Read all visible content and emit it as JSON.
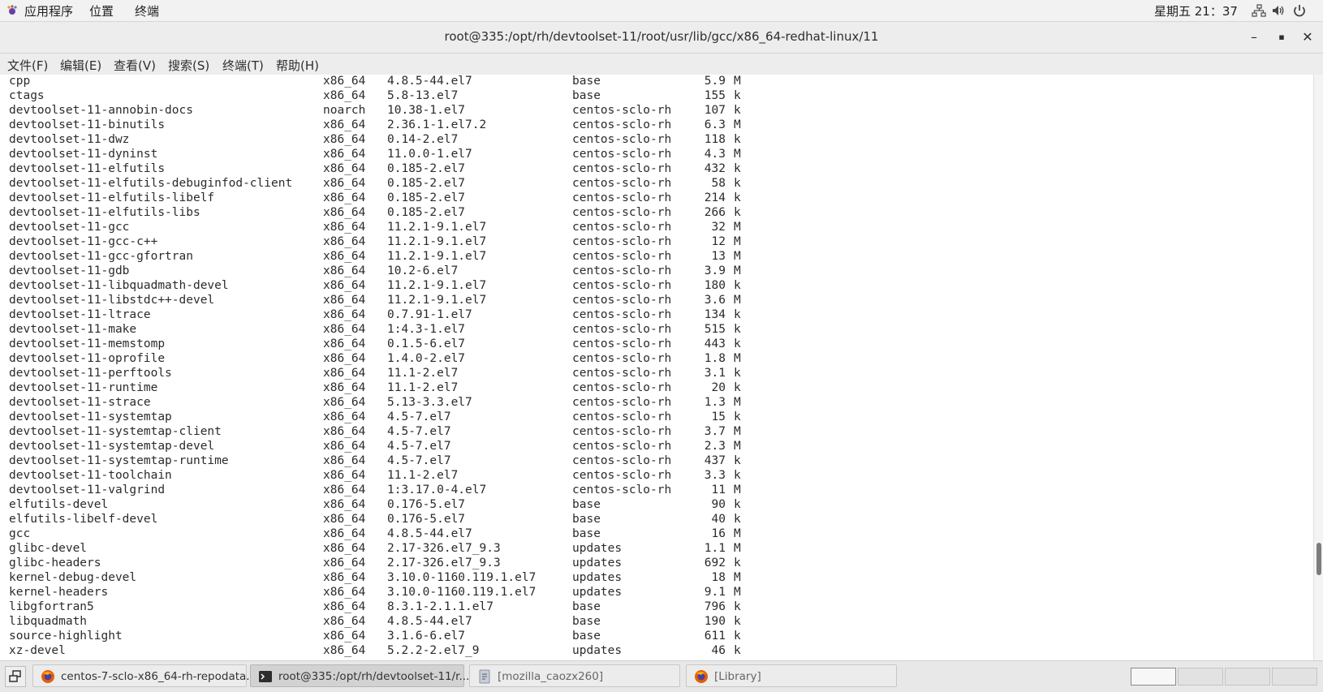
{
  "top_panel": {
    "applications": "应用程序",
    "places": "位置",
    "terminal": "终端",
    "clock": "星期五 21：37",
    "icons": [
      "network-icon",
      "volume-icon",
      "power-icon"
    ]
  },
  "window": {
    "title": "root@335:/opt/rh/devtoolset-11/root/usr/lib/gcc/x86_64-redhat-linux/11",
    "minimize": "–",
    "maximize": "▪",
    "close": "✕"
  },
  "menubar": {
    "file": "文件(F)",
    "edit": "编辑(E)",
    "view": "查看(V)",
    "search": "搜索(S)",
    "terminal": "终端(T)",
    "help": "帮助(H)"
  },
  "terminal": {
    "rows": [
      [
        "cpp",
        "x86_64",
        "4.8.5-44.el7",
        "base",
        "5.9",
        "M"
      ],
      [
        "ctags",
        "x86_64",
        "5.8-13.el7",
        "base",
        "155",
        "k"
      ],
      [
        "devtoolset-11-annobin-docs",
        "noarch",
        "10.38-1.el7",
        "centos-sclo-rh",
        "107",
        "k"
      ],
      [
        "devtoolset-11-binutils",
        "x86_64",
        "2.36.1-1.el7.2",
        "centos-sclo-rh",
        "6.3",
        "M"
      ],
      [
        "devtoolset-11-dwz",
        "x86_64",
        "0.14-2.el7",
        "centos-sclo-rh",
        "118",
        "k"
      ],
      [
        "devtoolset-11-dyninst",
        "x86_64",
        "11.0.0-1.el7",
        "centos-sclo-rh",
        "4.3",
        "M"
      ],
      [
        "devtoolset-11-elfutils",
        "x86_64",
        "0.185-2.el7",
        "centos-sclo-rh",
        "432",
        "k"
      ],
      [
        "devtoolset-11-elfutils-debuginfod-client",
        "x86_64",
        "0.185-2.el7",
        "centos-sclo-rh",
        "58",
        "k"
      ],
      [
        "devtoolset-11-elfutils-libelf",
        "x86_64",
        "0.185-2.el7",
        "centos-sclo-rh",
        "214",
        "k"
      ],
      [
        "devtoolset-11-elfutils-libs",
        "x86_64",
        "0.185-2.el7",
        "centos-sclo-rh",
        "266",
        "k"
      ],
      [
        "devtoolset-11-gcc",
        "x86_64",
        "11.2.1-9.1.el7",
        "centos-sclo-rh",
        "32",
        "M"
      ],
      [
        "devtoolset-11-gcc-c++",
        "x86_64",
        "11.2.1-9.1.el7",
        "centos-sclo-rh",
        "12",
        "M"
      ],
      [
        "devtoolset-11-gcc-gfortran",
        "x86_64",
        "11.2.1-9.1.el7",
        "centos-sclo-rh",
        "13",
        "M"
      ],
      [
        "devtoolset-11-gdb",
        "x86_64",
        "10.2-6.el7",
        "centos-sclo-rh",
        "3.9",
        "M"
      ],
      [
        "devtoolset-11-libquadmath-devel",
        "x86_64",
        "11.2.1-9.1.el7",
        "centos-sclo-rh",
        "180",
        "k"
      ],
      [
        "devtoolset-11-libstdc++-devel",
        "x86_64",
        "11.2.1-9.1.el7",
        "centos-sclo-rh",
        "3.6",
        "M"
      ],
      [
        "devtoolset-11-ltrace",
        "x86_64",
        "0.7.91-1.el7",
        "centos-sclo-rh",
        "134",
        "k"
      ],
      [
        "devtoolset-11-make",
        "x86_64",
        "1:4.3-1.el7",
        "centos-sclo-rh",
        "515",
        "k"
      ],
      [
        "devtoolset-11-memstomp",
        "x86_64",
        "0.1.5-6.el7",
        "centos-sclo-rh",
        "443",
        "k"
      ],
      [
        "devtoolset-11-oprofile",
        "x86_64",
        "1.4.0-2.el7",
        "centos-sclo-rh",
        "1.8",
        "M"
      ],
      [
        "devtoolset-11-perftools",
        "x86_64",
        "11.1-2.el7",
        "centos-sclo-rh",
        "3.1",
        "k"
      ],
      [
        "devtoolset-11-runtime",
        "x86_64",
        "11.1-2.el7",
        "centos-sclo-rh",
        "20",
        "k"
      ],
      [
        "devtoolset-11-strace",
        "x86_64",
        "5.13-3.3.el7",
        "centos-sclo-rh",
        "1.3",
        "M"
      ],
      [
        "devtoolset-11-systemtap",
        "x86_64",
        "4.5-7.el7",
        "centos-sclo-rh",
        "15",
        "k"
      ],
      [
        "devtoolset-11-systemtap-client",
        "x86_64",
        "4.5-7.el7",
        "centos-sclo-rh",
        "3.7",
        "M"
      ],
      [
        "devtoolset-11-systemtap-devel",
        "x86_64",
        "4.5-7.el7",
        "centos-sclo-rh",
        "2.3",
        "M"
      ],
      [
        "devtoolset-11-systemtap-runtime",
        "x86_64",
        "4.5-7.el7",
        "centos-sclo-rh",
        "437",
        "k"
      ],
      [
        "devtoolset-11-toolchain",
        "x86_64",
        "11.1-2.el7",
        "centos-sclo-rh",
        "3.3",
        "k"
      ],
      [
        "devtoolset-11-valgrind",
        "x86_64",
        "1:3.17.0-4.el7",
        "centos-sclo-rh",
        "11",
        "M"
      ],
      [
        "elfutils-devel",
        "x86_64",
        "0.176-5.el7",
        "base",
        "90",
        "k"
      ],
      [
        "elfutils-libelf-devel",
        "x86_64",
        "0.176-5.el7",
        "base",
        "40",
        "k"
      ],
      [
        "gcc",
        "x86_64",
        "4.8.5-44.el7",
        "base",
        "16",
        "M"
      ],
      [
        "glibc-devel",
        "x86_64",
        "2.17-326.el7_9.3",
        "updates",
        "1.1",
        "M"
      ],
      [
        "glibc-headers",
        "x86_64",
        "2.17-326.el7_9.3",
        "updates",
        "692",
        "k"
      ],
      [
        "kernel-debug-devel",
        "x86_64",
        "3.10.0-1160.119.1.el7",
        "updates",
        "18",
        "M"
      ],
      [
        "kernel-headers",
        "x86_64",
        "3.10.0-1160.119.1.el7",
        "updates",
        "9.1",
        "M"
      ],
      [
        "libgfortran5",
        "x86_64",
        "8.3.1-2.1.1.el7",
        "base",
        "796",
        "k"
      ],
      [
        "libquadmath",
        "x86_64",
        "4.8.5-44.el7",
        "base",
        "190",
        "k"
      ],
      [
        "source-highlight",
        "x86_64",
        "3.1.6-6.el7",
        "base",
        "611",
        "k"
      ],
      [
        "xz-devel",
        "x86_64",
        "5.2.2-2.el7_9",
        "updates",
        "46",
        "k"
      ]
    ]
  },
  "taskbar": {
    "tasks": [
      {
        "label": "centos-7-sclo-x86_64-rh-repodata...",
        "icon": "firefox-icon"
      },
      {
        "label": "root@335:/opt/rh/devtoolset-11/r...",
        "icon": "terminal-icon"
      },
      {
        "label": "[mozilla_caozx260]",
        "icon": "file-manager-icon"
      },
      {
        "label": "[Library]",
        "icon": "firefox-icon"
      }
    ]
  },
  "colors": {
    "firefox": "#e66000",
    "terminal_icon": "#2d2d2d"
  }
}
